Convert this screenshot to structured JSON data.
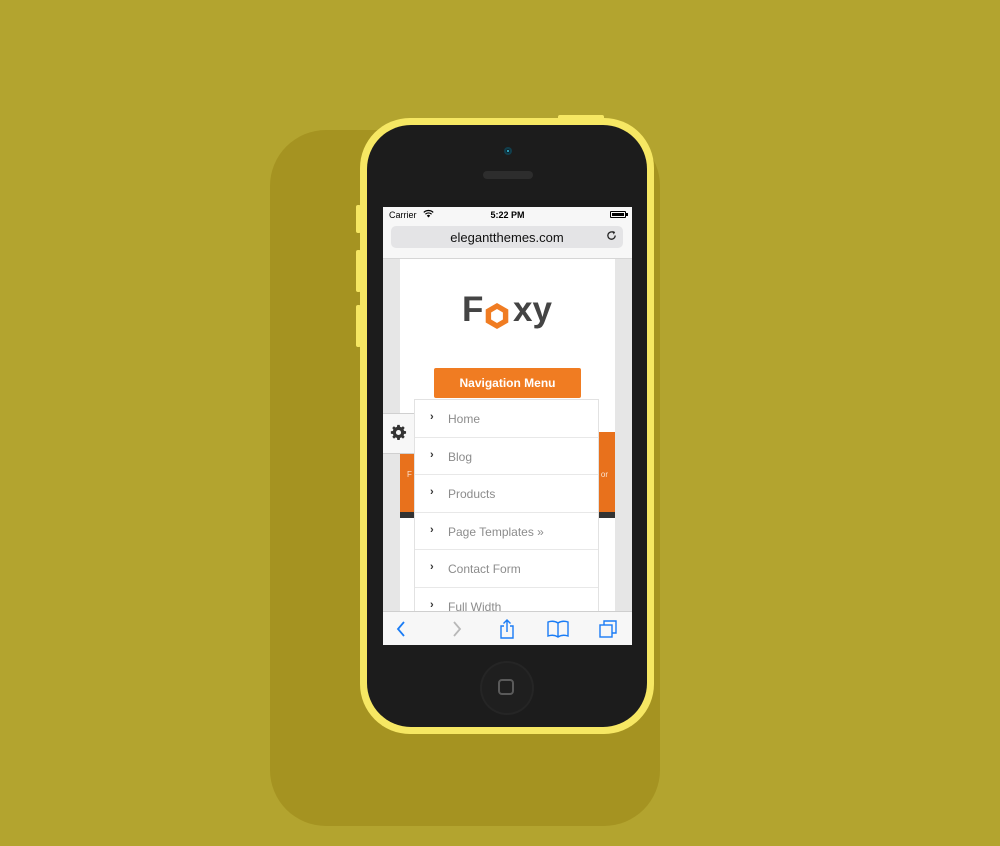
{
  "device": {
    "status_bar": {
      "carrier": "Carrier",
      "time": "5:22 PM"
    },
    "url": "elegantthemes.com"
  },
  "site": {
    "logo": {
      "first": "F",
      "rest": "xy"
    },
    "nav_button": "Navigation Menu",
    "band_text_left": "F",
    "band_text_right": "or",
    "menu_items": [
      {
        "label": "Home"
      },
      {
        "label": "Blog"
      },
      {
        "label": "Products"
      },
      {
        "label": "Page Templates »"
      },
      {
        "label": "Contact Form"
      },
      {
        "label": "Full Width"
      }
    ]
  },
  "colors": {
    "background": "#b3a42f",
    "phone_body": "#f6e763",
    "accent_orange": "#f07c22",
    "safari_blue": "#1a7cf5"
  },
  "icons": [
    "wifi-icon",
    "battery-icon",
    "reload-icon",
    "gear-icon",
    "chevron-right-icon",
    "back-icon",
    "forward-icon",
    "share-icon",
    "bookmarks-icon",
    "tabs-icon"
  ]
}
